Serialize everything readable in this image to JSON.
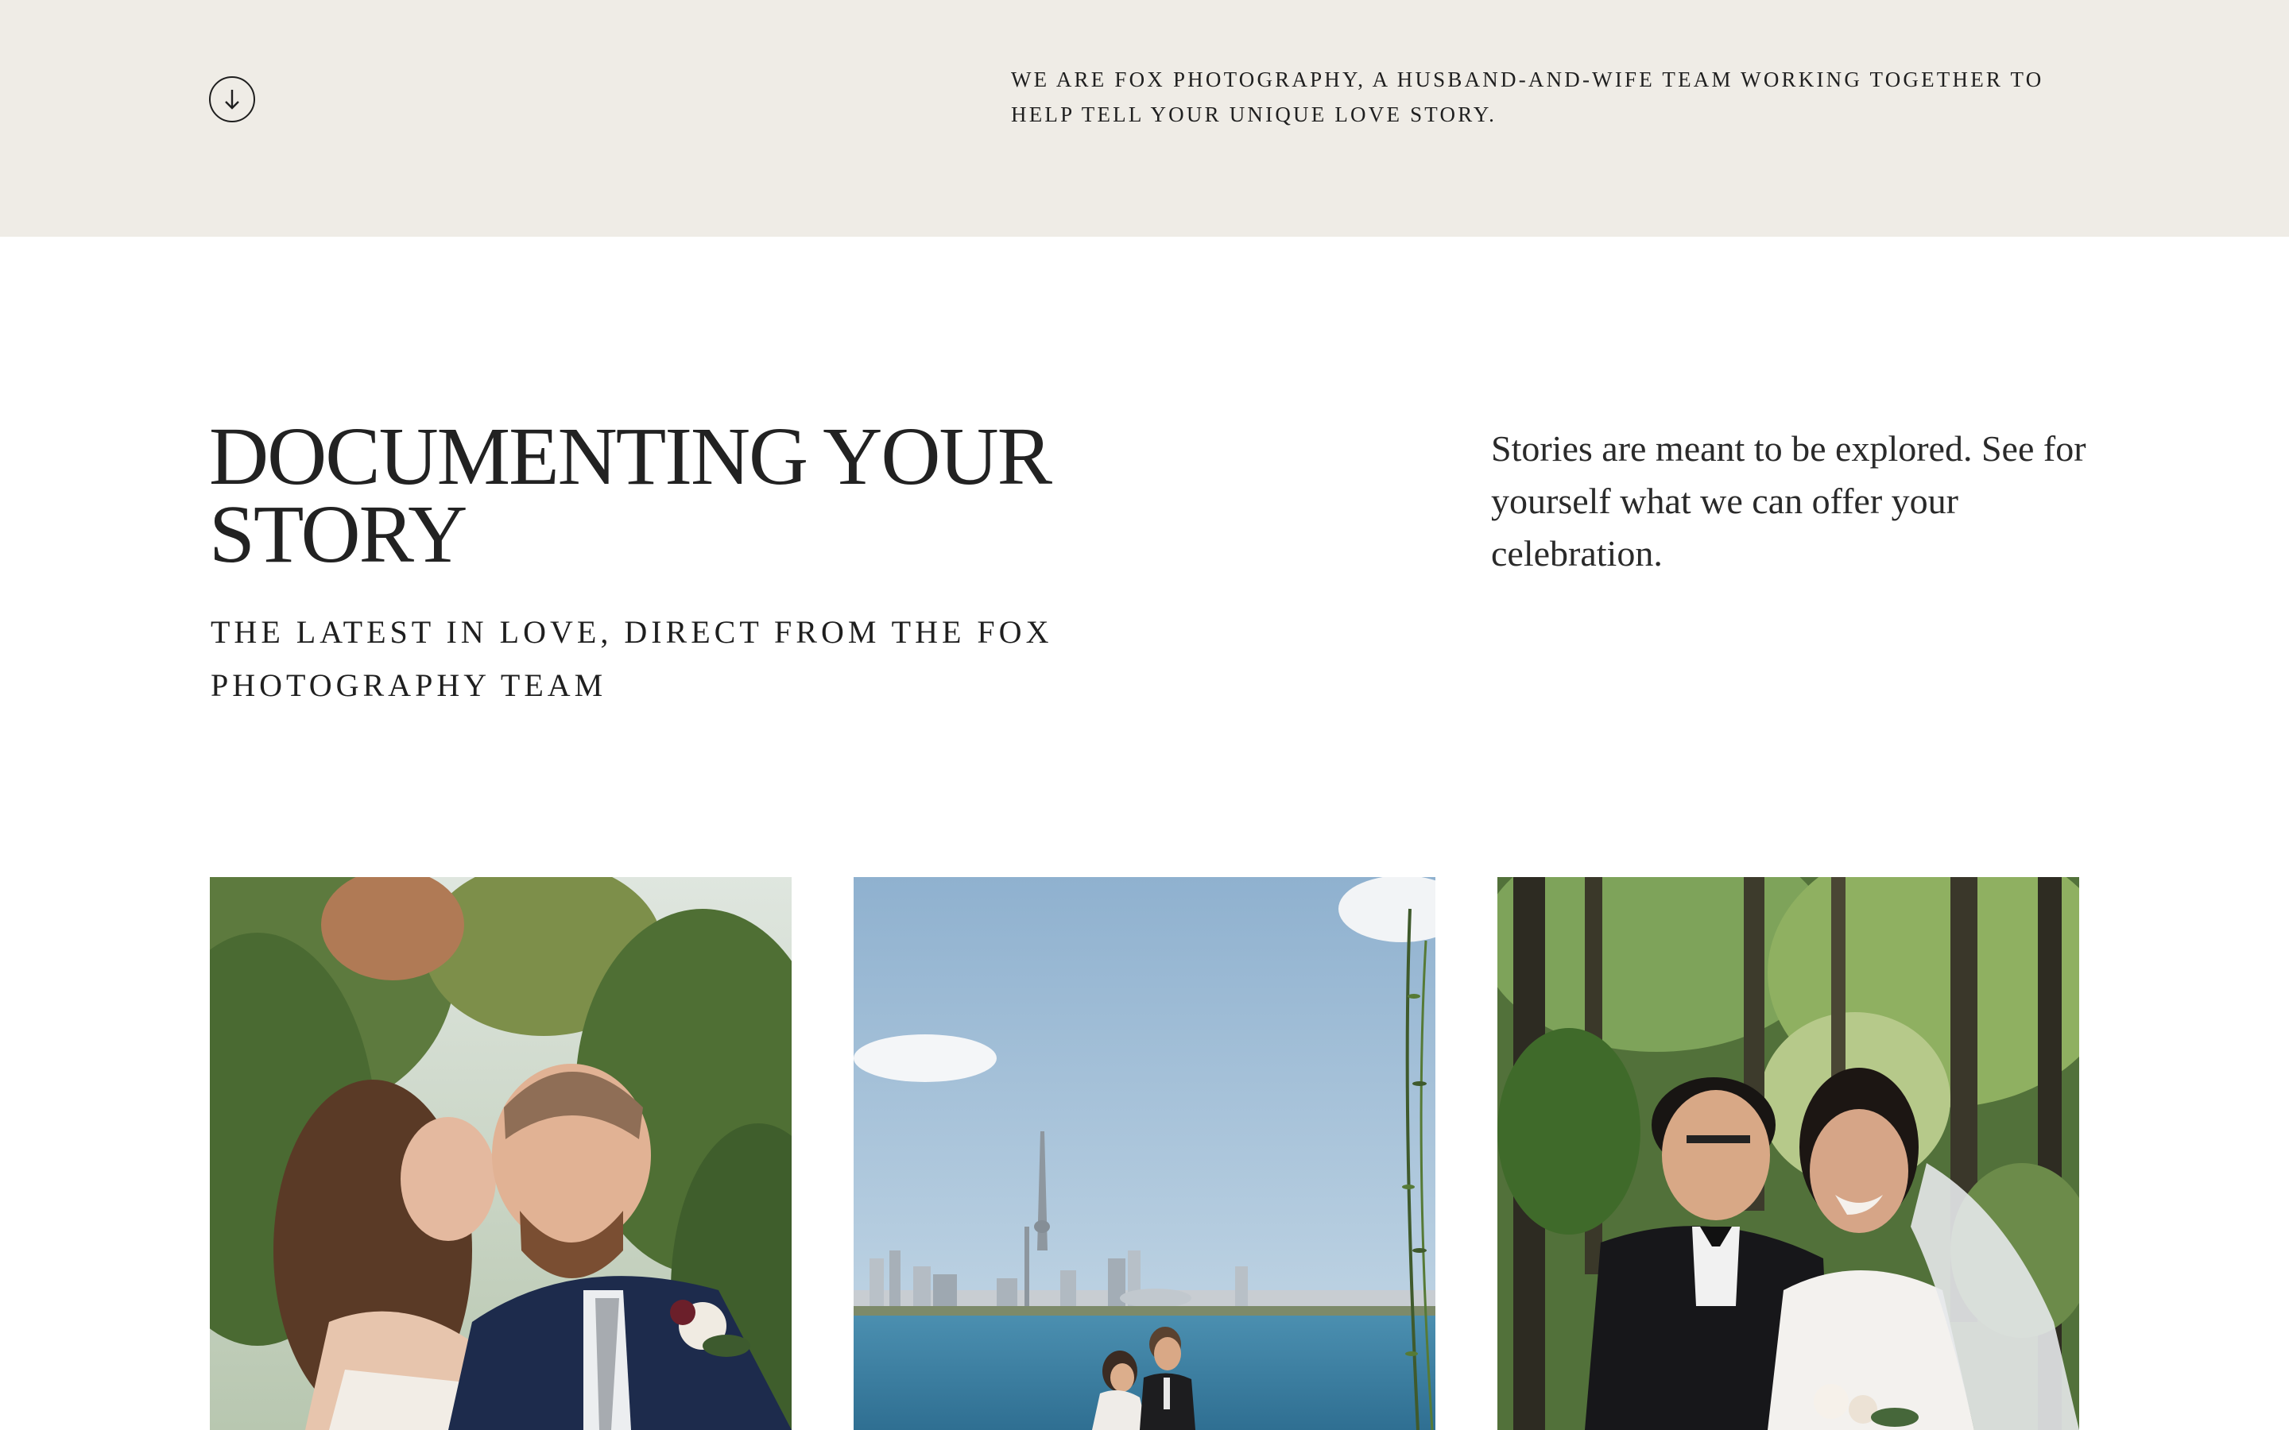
{
  "hero": {
    "scroll_icon": "arrow-down-circle-icon",
    "intro": "We are Fox Photography, a husband-and-wife team working together to help tell your unique love story."
  },
  "stories": {
    "title": "Documenting your story",
    "subtitle": "The latest in love, direct from the Fox Photography team",
    "blurb": "Stories are meant to be explored. See for yourself what we can offer your celebration."
  },
  "gallery": {
    "items": [
      {
        "subject": "couple-kiss-garden-photo"
      },
      {
        "subject": "couple-toronto-skyline-lake-photo"
      },
      {
        "subject": "couple-forest-laughing-photo"
      }
    ]
  },
  "colors": {
    "band": "#efece6",
    "text": "#1f1f1f"
  }
}
